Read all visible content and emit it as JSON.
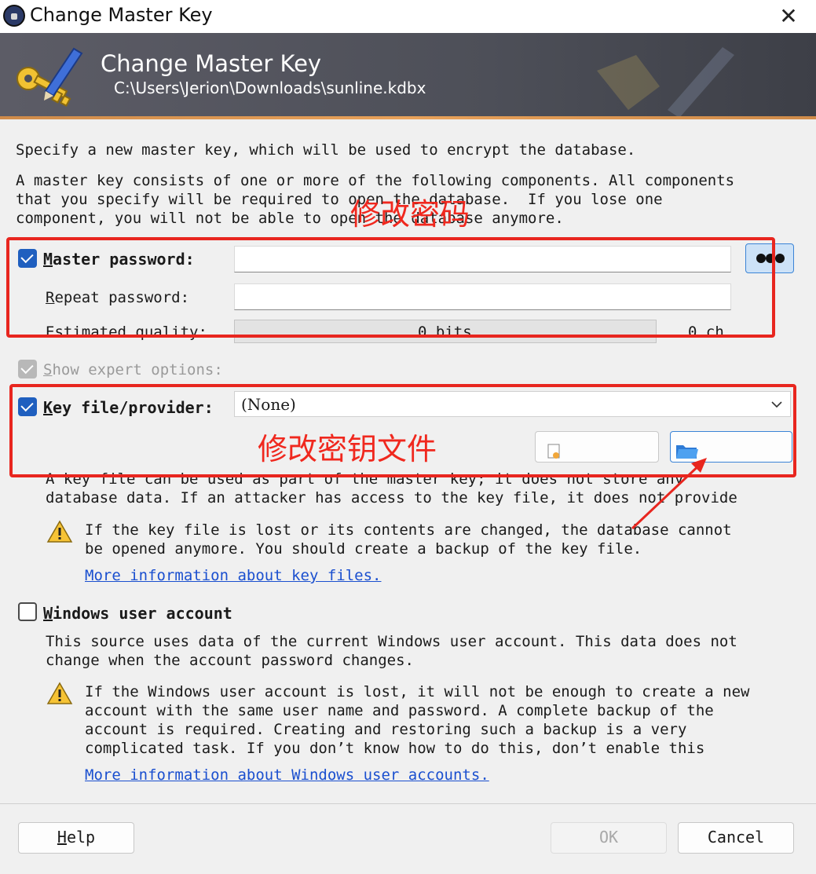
{
  "window": {
    "title": "Change Master Key",
    "close_glyph": "✕"
  },
  "banner": {
    "title": "Change Master Key",
    "path": "C:\\Users\\Jerion\\Downloads\\sunline.kdbx"
  },
  "intro": {
    "line1": "Specify a new master key, which will be used to encrypt the database.",
    "line2": "A master key consists of one or more of the following components. All components",
    "line3": "that you specify will be required to open the database.  If you lose one",
    "line4": "component, you will not be able to open the database anymore."
  },
  "password": {
    "label_first": "M",
    "label_rest": "aster password:",
    "repeat_first": "R",
    "repeat_rest": "epeat password:",
    "quality_label": "Estimated quality:",
    "quality_bits": "0 bits",
    "quality_ch": "0 ch",
    "value": "",
    "repeat_value": "",
    "show_toggle_icon": "dots-icon",
    "checked": true
  },
  "expert": {
    "label_first": "S",
    "label_rest": "how expert options:",
    "checked": true,
    "disabled": true
  },
  "keyfile": {
    "label_first": "K",
    "label_rest": "ey file/provider:",
    "selected": "(None)",
    "checked": true,
    "desc1": "A key file can be used as part of the master key; it does not store any",
    "desc2": "database data. If an attacker has access to the key file, it does not provide",
    "warn1": "If the key file is lost or its contents are changed, the database cannot",
    "warn2": "be opened anymore. You should create a backup of the key file.",
    "link": "More information about key files."
  },
  "winuser": {
    "label_first": "W",
    "label_rest": "indows user account",
    "checked": false,
    "desc1": "This source uses data of the current Windows user account. This data does not",
    "desc2": "change when the account password changes.",
    "warn1": "If the Windows user account is lost, it will not be enough to create a new",
    "warn2": "account with the same user name and password. A complete backup of the",
    "warn3": "account is required. Creating and restoring such a backup is a very",
    "warn4": "complicated task. If you don’t know how to do this, don’t enable this",
    "link": "More information about Windows user accounts."
  },
  "buttons": {
    "help_first": "H",
    "help_rest": "elp",
    "ok": "OK",
    "cancel": "Cancel"
  },
  "annotations": {
    "password_note": "修改密码",
    "keyfile_note": "修改密钥文件"
  },
  "colors": {
    "annotation": "#e8261f",
    "accent": "#1f5fbf",
    "link": "#1a4fcf"
  }
}
